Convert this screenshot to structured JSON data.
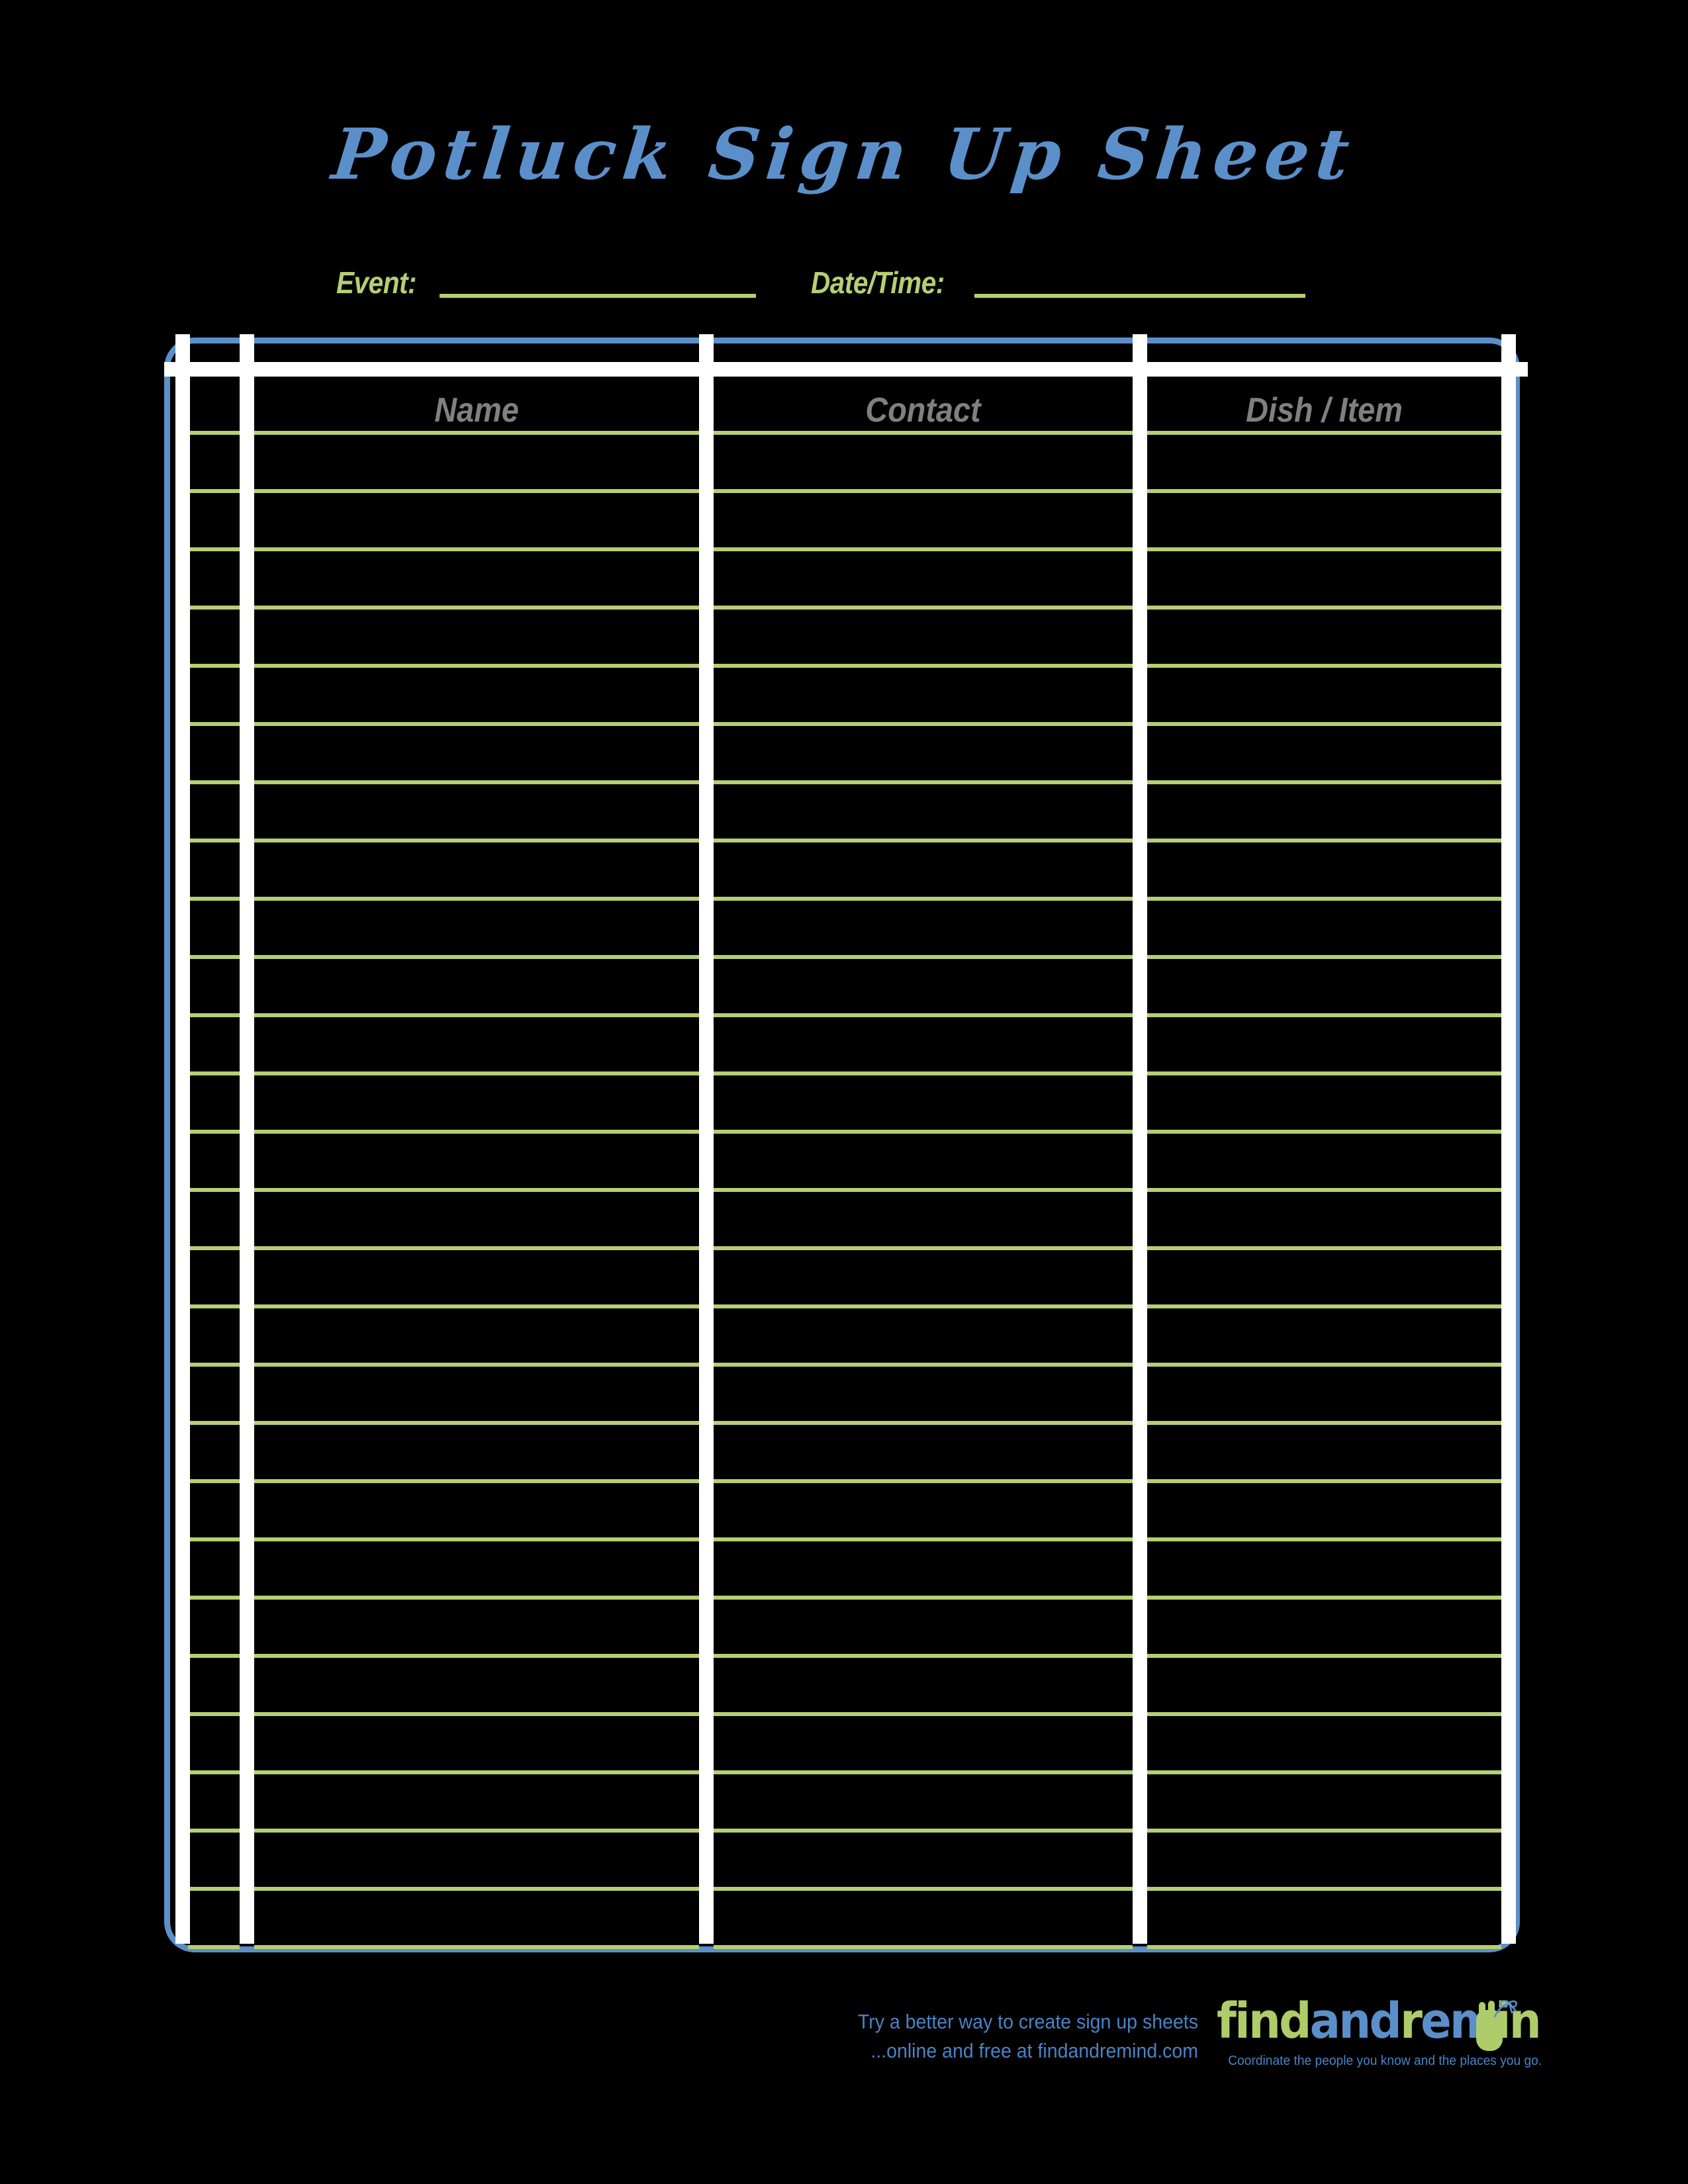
{
  "page": {
    "title": "Potluck Sign Up Sheet",
    "accent_blue": "#5b8fc9",
    "accent_green": "#b5cf72",
    "header_gray": "#808080",
    "background": "#000000"
  },
  "meta": {
    "event_label": "Event:",
    "event_value": "",
    "event_placeholder": "",
    "datetime_label": "Date/Time:",
    "datetime_value": "",
    "datetime_placeholder": ""
  },
  "table": {
    "columns": [
      {
        "key": "num",
        "label": ""
      },
      {
        "key": "name",
        "label": "Name"
      },
      {
        "key": "contact",
        "label": "Contact"
      },
      {
        "key": "dish",
        "label": "Dish / Item"
      }
    ],
    "row_count": 27,
    "rows": [
      {
        "num": "",
        "name": "",
        "contact": "",
        "dish": ""
      },
      {
        "num": "",
        "name": "",
        "contact": "",
        "dish": ""
      },
      {
        "num": "",
        "name": "",
        "contact": "",
        "dish": ""
      },
      {
        "num": "",
        "name": "",
        "contact": "",
        "dish": ""
      },
      {
        "num": "",
        "name": "",
        "contact": "",
        "dish": ""
      },
      {
        "num": "",
        "name": "",
        "contact": "",
        "dish": ""
      },
      {
        "num": "",
        "name": "",
        "contact": "",
        "dish": ""
      },
      {
        "num": "",
        "name": "",
        "contact": "",
        "dish": ""
      },
      {
        "num": "",
        "name": "",
        "contact": "",
        "dish": ""
      },
      {
        "num": "",
        "name": "",
        "contact": "",
        "dish": ""
      },
      {
        "num": "",
        "name": "",
        "contact": "",
        "dish": ""
      },
      {
        "num": "",
        "name": "",
        "contact": "",
        "dish": ""
      },
      {
        "num": "",
        "name": "",
        "contact": "",
        "dish": ""
      },
      {
        "num": "",
        "name": "",
        "contact": "",
        "dish": ""
      },
      {
        "num": "",
        "name": "",
        "contact": "",
        "dish": ""
      },
      {
        "num": "",
        "name": "",
        "contact": "",
        "dish": ""
      },
      {
        "num": "",
        "name": "",
        "contact": "",
        "dish": ""
      },
      {
        "num": "",
        "name": "",
        "contact": "",
        "dish": ""
      },
      {
        "num": "",
        "name": "",
        "contact": "",
        "dish": ""
      },
      {
        "num": "",
        "name": "",
        "contact": "",
        "dish": ""
      },
      {
        "num": "",
        "name": "",
        "contact": "",
        "dish": ""
      },
      {
        "num": "",
        "name": "",
        "contact": "",
        "dish": ""
      },
      {
        "num": "",
        "name": "",
        "contact": "",
        "dish": ""
      },
      {
        "num": "",
        "name": "",
        "contact": "",
        "dish": ""
      },
      {
        "num": "",
        "name": "",
        "contact": "",
        "dish": ""
      },
      {
        "num": "",
        "name": "",
        "contact": "",
        "dish": ""
      },
      {
        "num": "",
        "name": "",
        "contact": "",
        "dish": ""
      }
    ]
  },
  "footer": {
    "promo_line1": "Try a better way to create sign up sheets",
    "promo_line2": "...online and free at findandremind.com",
    "logo": {
      "part1": "find",
      "part2": "and",
      "part3": "r",
      "part4": "em",
      "part5": "in",
      "tagline": "Coordinate the people you know and the places you go.",
      "green": "#aecd6a",
      "blue": "#5b8fc9"
    }
  }
}
